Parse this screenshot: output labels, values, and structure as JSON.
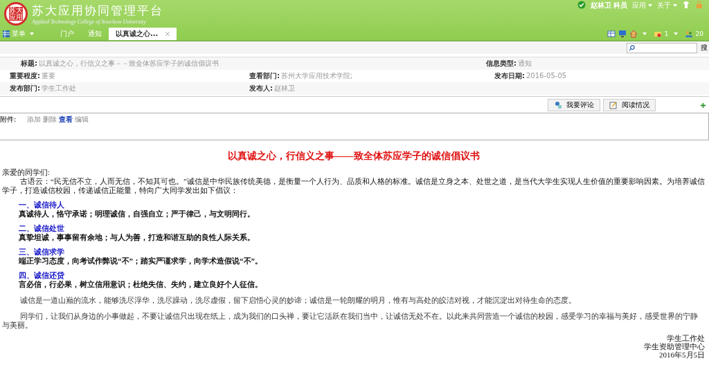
{
  "header": {
    "title": "苏大应用协同管理平台",
    "subtitle": "Applied Technology College of Soochow University",
    "logo_text": "苏大应用",
    "user": "赵林卫 科员",
    "menus": [
      "应用",
      "关于"
    ],
    "mail_count": "1",
    "online_count": "20"
  },
  "tabs": [
    {
      "label": "菜单",
      "kind": "menu",
      "selected": false
    },
    {
      "label": "门户",
      "kind": "tab",
      "selected": false
    },
    {
      "label": "通知",
      "kind": "tab",
      "selected": false
    },
    {
      "label": "以真诚之心...",
      "kind": "closable",
      "selected": true
    }
  ],
  "search": {
    "button": "搜"
  },
  "meta": [
    [
      {
        "label": "标题:",
        "value": "以真诚之心，行信义之事－－致全体苏应学子的诚信倡议书"
      },
      {
        "label": "信息类型:",
        "value": "通知"
      }
    ],
    [
      {
        "label": "重要程度:",
        "value": "重要"
      },
      {
        "label": "查看部门:",
        "value": "苏州大学应用技术学院;"
      },
      {
        "label": "发布日期:",
        "value": "2016-05-05"
      }
    ],
    [
      {
        "label": "发布部门:",
        "value": "学生工作处"
      },
      {
        "label": "发布人:",
        "value": "赵林卫"
      }
    ]
  ],
  "actions": [
    "我要评论",
    "阅读情况"
  ],
  "attachment": {
    "label": "附件:",
    "links": [
      {
        "text": "添加",
        "highlighted": false
      },
      {
        "text": "删除",
        "highlighted": false
      },
      {
        "text": "查看",
        "highlighted": true
      },
      {
        "text": "编辑",
        "highlighted": false
      }
    ]
  },
  "article": {
    "title": "以真诚之心，行信义之事——致全体苏应学子的诚信倡议书",
    "greeting": "亲爱的同学们:",
    "intro": "古语云：“民无信不立，人而无信，不知其可也。”诚信是中华民族传统美德，是衡量一个人行为、品质和人格的标准。诚信是立身之本、处世之道，是当代大学生实现人生价值的重要影响因素。为培养诚信学子，打造诚信校园，传递诚信正能量，特向广大同学发出如下倡议：",
    "sections": [
      {
        "heading": "一、诚信待人",
        "text": "真诚待人，恪守承诺；明理诚信，自强自立；严于律己，与文明同行。"
      },
      {
        "heading": "二、诚信处世",
        "text": "真挚坦诚，事事留有余地；与人为善，打造和谐互助的良性人际关系。"
      },
      {
        "heading": "三、诚信求学",
        "text": "端正学习态度，向考试作弊说“不”；踏实严谨求学，向学术造假说“不”。"
      },
      {
        "heading": "四、诚信还贷",
        "text": "言必信，行必果，树立信用意识；杜绝失信、失约，建立良好个人征信。"
      }
    ],
    "closing": [
      "诚信是一道山巅的流水，能够洗尽浮华，洗尽躁动，洗尽虚假，留下启悟心灵的妙谛；诚信是一轮朗耀的明月，惟有与高处的皎洁对视，才能沉淀出对待生命的态度。",
      "同学们，让我们从身边的小事做起，不要让诚信只出现在纸上，成为我们的口头禅，要让它活跃在我们当中，让诚信无处不在。以此来共同营造一个诚信的校园，感受学习的幸福与美好，感受世界的宁静与美丽。"
    ],
    "signature": [
      "学生工作处",
      "学生资助管理中心",
      "2016年5月5日"
    ]
  }
}
